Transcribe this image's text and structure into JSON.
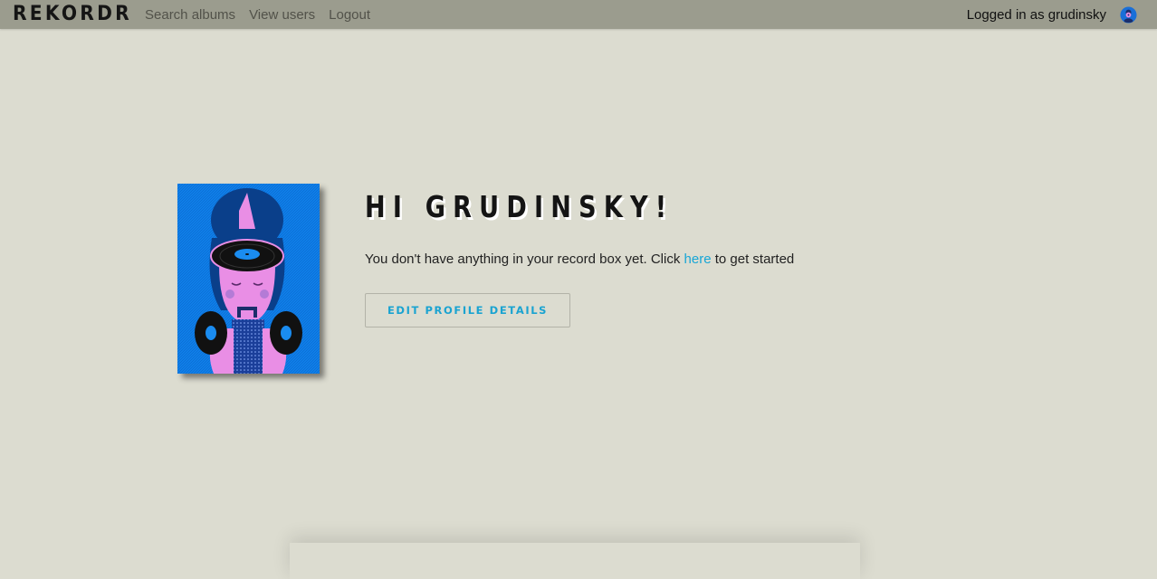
{
  "navbar": {
    "brand": "REKORDR",
    "links": [
      {
        "label": "Search albums"
      },
      {
        "label": "View users"
      },
      {
        "label": "Logout"
      }
    ],
    "logged_in_text": "Logged in as grudinsky",
    "avatar_icon": "user-avatar-icon"
  },
  "profile": {
    "image_icon": "vinyl-head-illustration",
    "greeting": "Hi grudinsky!",
    "message_before": "You don't have anything in your record box yet. Click ",
    "message_link": "here",
    "message_after": " to get started",
    "edit_button": "Edit profile details"
  },
  "colors": {
    "navbar_bg": "#9b9c8e",
    "page_bg": "#dcdcd0",
    "accent": "#1aa3d1"
  }
}
